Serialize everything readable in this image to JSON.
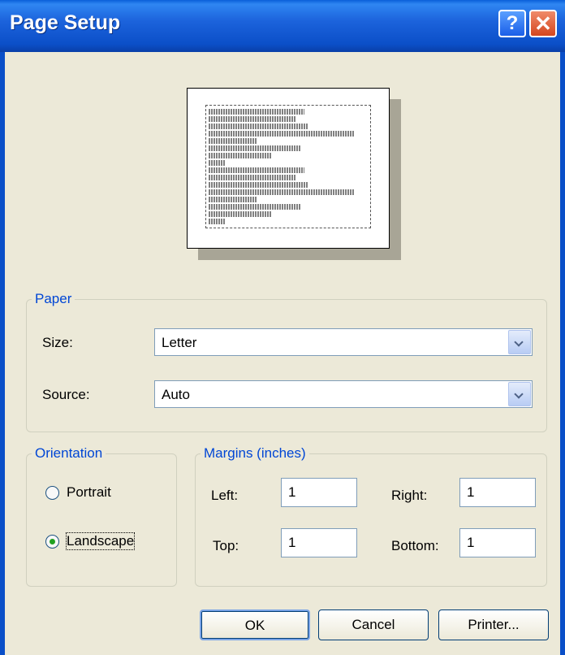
{
  "window": {
    "title": "Page Setup",
    "help_symbol": "?",
    "close_symbol": "✕"
  },
  "icons": [
    "help-icon",
    "close-icon",
    "chevron-down-icon"
  ],
  "paper": {
    "legend": "Paper",
    "size_label": "Size:",
    "size_value": "Letter",
    "source_label": "Source:",
    "source_value": "Auto"
  },
  "orientation": {
    "legend": "Orientation",
    "portrait_label": "Portrait",
    "landscape_label": "Landscape",
    "selected": "Landscape"
  },
  "margins": {
    "legend": "Margins (inches)",
    "left_label": "Left:",
    "left_value": "1",
    "right_label": "Right:",
    "right_value": "1",
    "top_label": "Top:",
    "top_value": "1",
    "bottom_label": "Bottom:",
    "bottom_value": "1"
  },
  "buttons": {
    "ok": "OK",
    "cancel": "Cancel",
    "printer": "Printer..."
  }
}
